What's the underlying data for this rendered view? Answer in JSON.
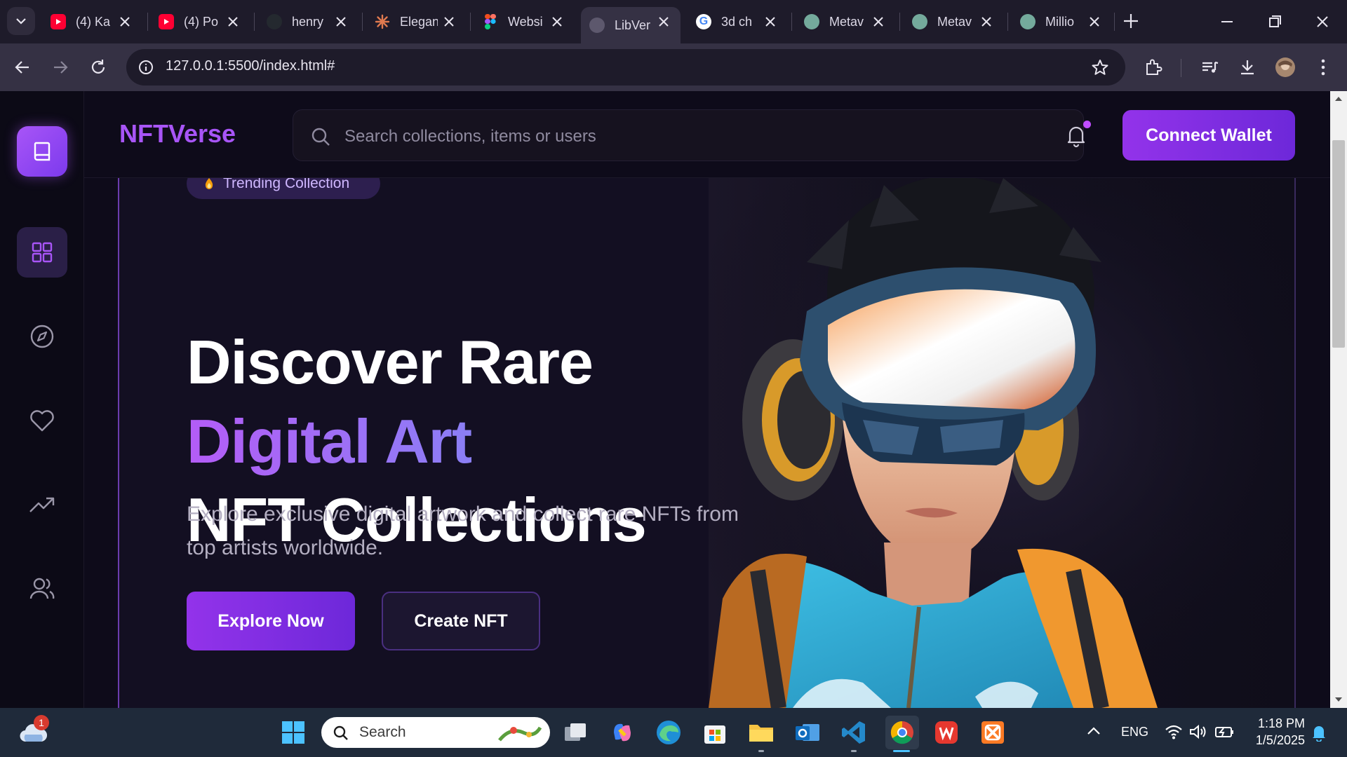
{
  "browser": {
    "tabs": [
      {
        "title": "(4) Ka",
        "icon": "youtube-icon"
      },
      {
        "title": "(4) Po",
        "icon": "youtube-icon"
      },
      {
        "title": "henry",
        "icon": "github-icon"
      },
      {
        "title": "Elegan",
        "icon": "claude-icon"
      },
      {
        "title": "Websi",
        "icon": "figma-icon"
      },
      {
        "title": "LibVer",
        "icon": "globe-icon"
      },
      {
        "title": "3d ch",
        "icon": "google-icon"
      },
      {
        "title": "Metav",
        "icon": "chatgpt-icon"
      },
      {
        "title": "Metav",
        "icon": "chatgpt-icon"
      },
      {
        "title": "Millio",
        "icon": "chatgpt-icon"
      }
    ],
    "active_tab_index": 5,
    "url": "127.0.0.1:5500/index.html#"
  },
  "app": {
    "brand": "NFTVerse",
    "search_placeholder": "Search collections, items or users",
    "connect_wallet": "Connect Wallet",
    "sidebar": [
      "dashboard",
      "explore",
      "favorites",
      "trending",
      "community"
    ],
    "accent": "#a855f7"
  },
  "hero": {
    "badge": "Trending Collection",
    "line1": "Discover Rare",
    "line2": "Digital Art",
    "line3": "NFT Collections",
    "subtitle": "Explore exclusive digital artwork and collect rare NFTs from top artists worldwide.",
    "primary_cta": "Explore Now",
    "secondary_cta": "Create NFT"
  },
  "taskbar": {
    "search_label": "Search",
    "language": "ENG",
    "time": "1:18 PM",
    "date": "1/5/2025",
    "weather_badge": "1"
  }
}
